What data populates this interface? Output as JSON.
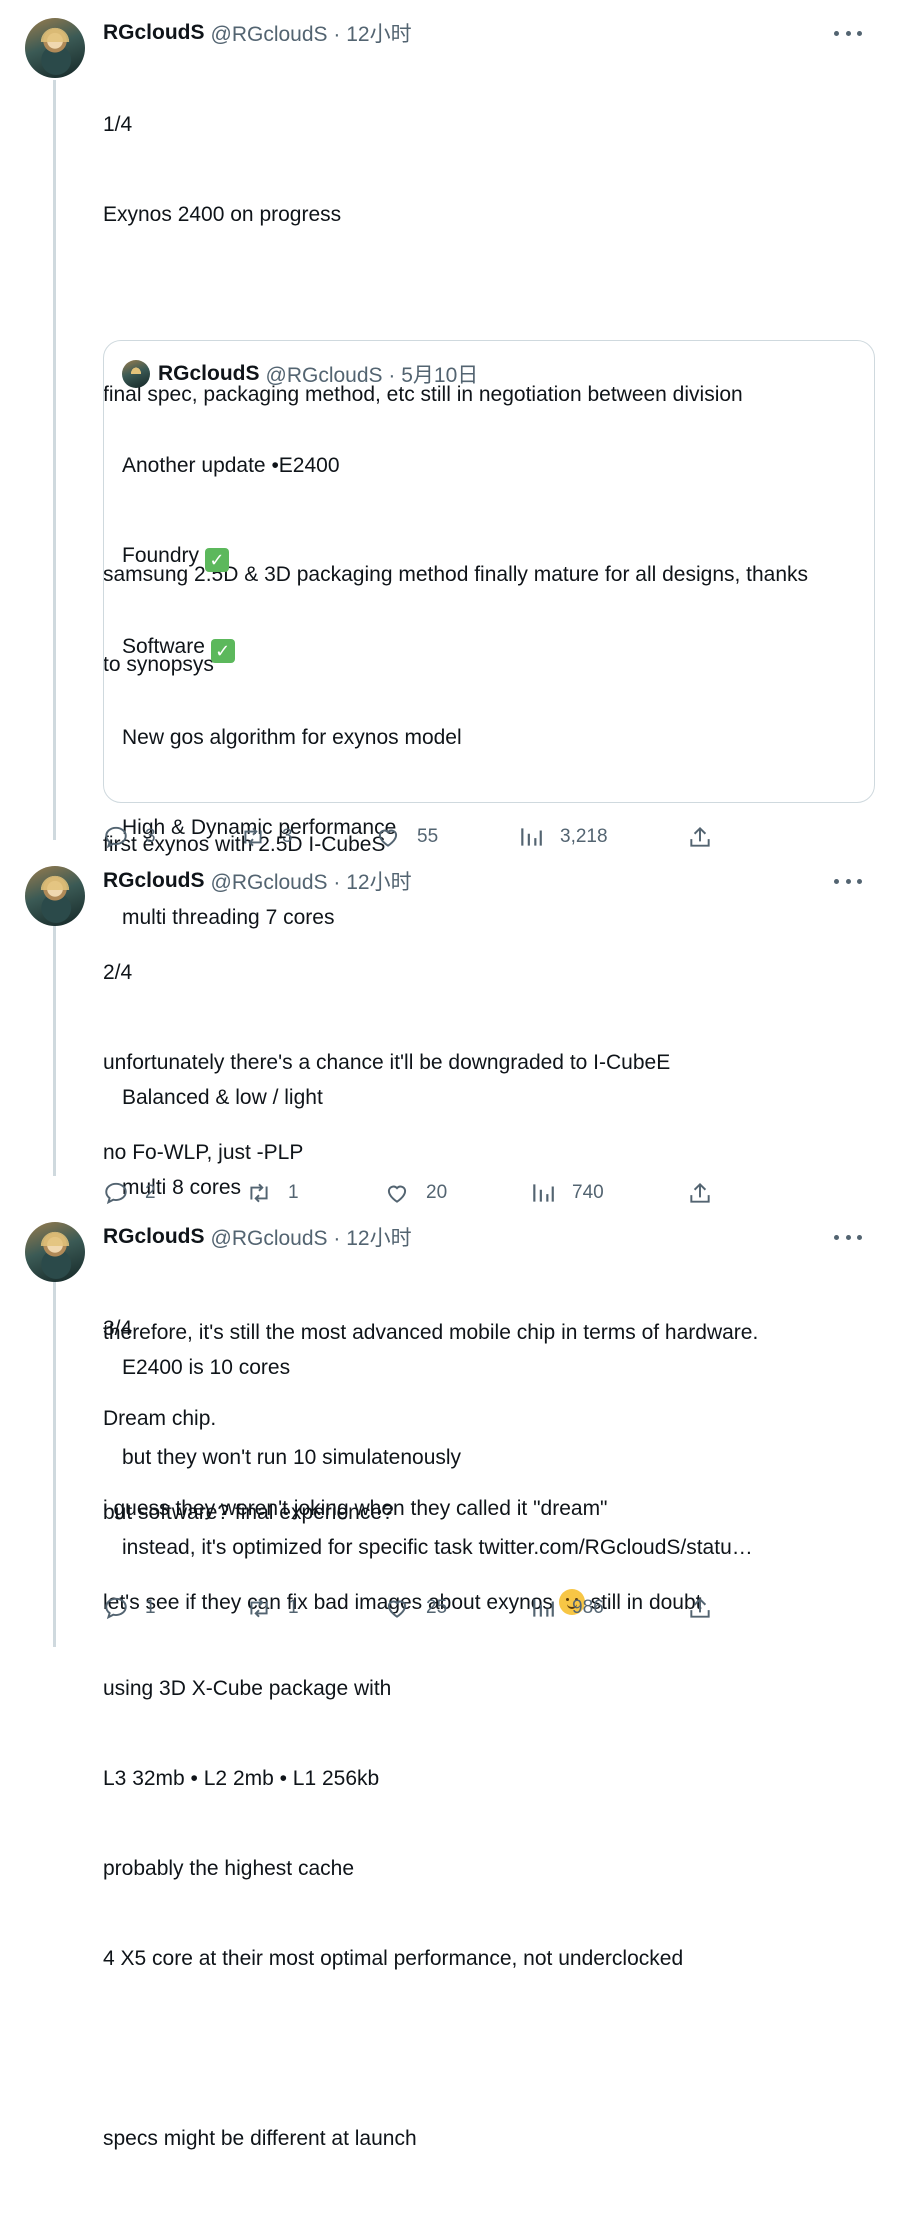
{
  "tweets": [
    {
      "name": "RGcloudS",
      "handle": "@RGcloudS · 12小时",
      "index": "1/4",
      "lines": [
        "Exynos 2400 on progress",
        "",
        "final spec, packaging method, etc still in negotiation between division",
        "",
        "samsung 2.5D & 3D packaging method finally mature for all designs, thanks",
        "to synopsys",
        "",
        "first exynos with 2.5D I-CubeS"
      ],
      "quote": {
        "name": "RGcloudS",
        "handle": "@RGcloudS · 5月10日",
        "line1": "Another update •E2400",
        "line2": "Foundry ",
        "line3": "Software ",
        "check": "✓",
        "rest": [
          "New gos algorithm for exynos model",
          "High & Dynamic performance",
          "multi threading 7 cores",
          "",
          "Balanced & low / light",
          "multi 8 cores",
          "",
          "E2400 is 10 cores",
          "but they won't run 10 simulatenously",
          "instead, it's optimized for specific task twitter.com/RGcloudS/statu…"
        ]
      },
      "replies": "3",
      "retweets": "3",
      "likes": "55",
      "views": "3,218"
    },
    {
      "name": "RGcloudS",
      "handle": "@RGcloudS · 12小时",
      "index": "2/4",
      "lines": [
        "unfortunately there's a chance it'll be downgraded to I-CubeE",
        "no Fo-WLP, just -PLP",
        "",
        "therefore, it's still the most advanced mobile chip in terms of hardware.",
        "",
        "but software? final experience?"
      ],
      "last_before": "let's see if they can fix bad images about exynos ",
      "last_after": " still in doubt",
      "emoji": "melting-face-emoji",
      "replies": "2",
      "retweets": "1",
      "likes": "20",
      "views": "740"
    },
    {
      "name": "RGcloudS",
      "handle": "@RGcloudS · 12小时",
      "index": "3/4",
      "lines": [
        "Dream chip.",
        "i guess they weren't joking when they called it \"dream\"",
        "",
        "using 3D X-Cube package with",
        "L3 32mb • L2 2mb • L1 256kb",
        "probably the highest cache",
        "4 X5 core at their most optimal performance, not underclocked",
        "",
        "specs might be different at launch"
      ],
      "replies": "1",
      "retweets": "1",
      "likes": "25",
      "views": "986"
    }
  ],
  "colors": {
    "text": "#0f1419",
    "secondary": "#536471",
    "border": "#cfd9de",
    "check": "#5cb85c"
  }
}
